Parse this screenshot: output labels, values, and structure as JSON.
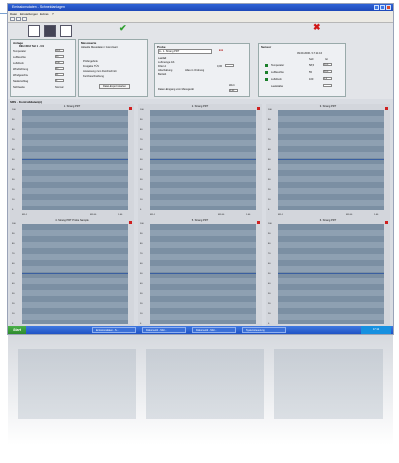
{
  "window": {
    "title": "Emissionsdaten - Schneidanlagen"
  },
  "menu": [
    "Datei",
    "Einstellungen",
    "Extras",
    "?"
  ],
  "panels": {
    "left": {
      "title": "Anlage",
      "subtitle": "DEH 3012 Teil 1 - 0/1",
      "rows": [
        {
          "label": "Temperatur",
          "value": "58,5"
        },
        {
          "label": "Luftfeuchte",
          "value": "55"
        },
        {
          "label": "Luftdruck",
          "value": "100"
        },
        {
          "label": "Windrichtung",
          "value": "62"
        },
        {
          "label": "Windgeschw.",
          "value": "31"
        },
        {
          "label": "Niederschlag",
          "value": "0"
        },
        {
          "label": "Sichtweite",
          "value": "Normal"
        }
      ]
    },
    "middle": {
      "title": "Messwerte",
      "lines": [
        "Aktuelle Messdaten / Grenzwert",
        "Prüfergebnis",
        "Freigabe TÜV",
        "Anweisung zum Durchschnitt",
        "Kurzbeschreibung"
      ],
      "button": "Datei-Export starten"
    },
    "probe": {
      "title": "Probe",
      "select": "A - 1. Strang PRT",
      "rows": [
        "Lastfall",
        "Luftmenge AS",
        "Filter A",
        "Abschaltung",
        "Betrieb"
      ],
      "value_a": "Alles in Ordnung",
      "value_b": "0,00",
      "footer": "Daten-Eingang vom Messgerät",
      "footer_r1": "Wert",
      "footer_r2": "0,00"
    },
    "status": {
      "title": "Sensor",
      "date": "09.09.2006 / 17:11:16",
      "items": [
        {
          "label": "Temperatur",
          "a": "58,5",
          "b": "30,0"
        },
        {
          "label": "Luftfeuchte",
          "a": "55",
          "b": "99,0"
        },
        {
          "label": "Luftdruck",
          "a": "100",
          "b": "0,0"
        },
        {
          "label": "Lautstärke",
          "a": "",
          "b": ""
        }
      ],
      "col_a": "Soll",
      "col_b": "Ist"
    }
  },
  "section": "SRS - Kontrolldaten(n)",
  "charts": [
    {
      "title": "1. Strang PRT",
      "x0": "M1-1",
      "x1": "M1-50",
      "x2": "1:40"
    },
    {
      "title": "2. Strang PRT",
      "x0": "M1-1",
      "x1": "M1-50",
      "x2": "1:40"
    },
    {
      "title": "3. Strang PRT",
      "x0": "M1-1",
      "x1": "M1-50",
      "x2": "1:40"
    },
    {
      "title": "4. Strang PRT Probe Sample",
      "x0": "M1-1",
      "x1": "M1-50",
      "x2": "1:40"
    },
    {
      "title": "5. Strang PRT",
      "x0": "M1-1",
      "x1": "M1-50",
      "x2": "1:40"
    },
    {
      "title": "6. Strang PRT",
      "x0": "M1-1",
      "x1": "M1-50",
      "x2": "1:40"
    }
  ],
  "yticks": [
    "100",
    "90",
    "80",
    "70",
    "60",
    "50",
    "40",
    "30",
    "20",
    "10",
    "0"
  ],
  "taskbar": {
    "start": "Start",
    "tasks": [
      "Emissionsdaten - S...",
      "Dokument1 - Micr...",
      "Dokument2 - Micr...",
      "Systemsteuerung"
    ],
    "clock": "17:11"
  }
}
